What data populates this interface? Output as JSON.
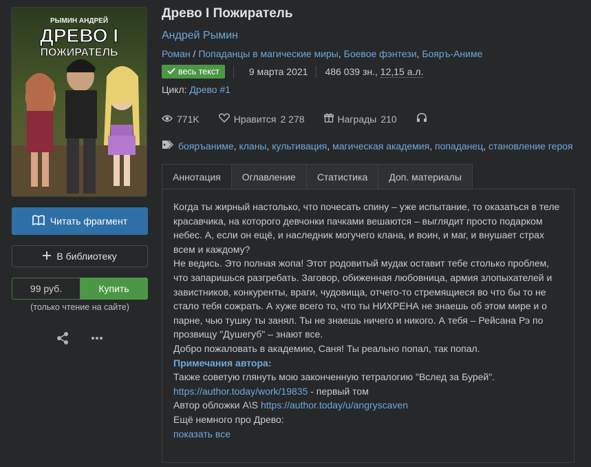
{
  "book": {
    "title": "Древо I Пожиратель",
    "author": "Андрей Рымин",
    "genre_main": "Роман",
    "genre_sep": " / ",
    "genres": [
      "Попаданцы в магические миры",
      "Боевое фэнтези",
      "Бояръ-Аниме"
    ],
    "status_badge": "весь текст",
    "date": "9 марта 2021",
    "size_chars": "486 039 зн., ",
    "size_al": "12,15 а.л.",
    "cycle_label": "Цикл:",
    "cycle_name": "Древо #1"
  },
  "cover": {
    "author_text": "РЫМИН АНДРЕЙ",
    "title_line1": "ДРЕВО I",
    "title_line2": "ПОЖИРАТЕЛЬ"
  },
  "stats": {
    "views": "771K",
    "likes_label": "Нравится",
    "likes": "2 278",
    "awards_label": "Награды",
    "awards": "210"
  },
  "tags": [
    "бояръаниме",
    "кланы",
    "культивация",
    "магическая академия",
    "попаданец",
    "становление героя"
  ],
  "tabs": [
    "Аннотация",
    "Оглавление",
    "Статистика",
    "Доп. материалы"
  ],
  "annotation": [
    "Когда ты жирный настолько, что почесать спину – уже испытание, то оказаться в теле красавчика, на которого девчонки пачками вешаются – выглядит просто подарком небес. А, если он ещё, и наследник могучего клана, и воин, и маг, и внушает страх всем и каждому?",
    "Не ведись. Это полная жопа! Этот родовитый мудак оставит тебе столько проблем, что запаришься разгребать. Заговор, обиженная любовница, армия злопыхателей и завистников, конкуренты, враги, чудовища, отчего-то стремящиеся во что бы то не стало тебя сожрать. А хуже всего то, что ты НИХРЕНА не знаешь об этом мире и о парне, чью тушку ты занял. Ты не знаешь ничего и никого. А тебя – Рейсана Рэ по прозвищу \"Душегуб\" – знают все.",
    "Добро пожаловать в академию, Саня! Ты реально попал, так попал."
  ],
  "notes": {
    "heading": "Примечания автора:",
    "line1": "Также советую глянуть мою законченную тетралогию \"Вслед за Бурей\".",
    "link1": "https://author.today/work/19835",
    "link1_suffix": " - первый том",
    "line3_prefix": "Автор обложки A\\S ",
    "link2": "https://author.today/u/angryscaven",
    "line4": "Ещё немного про Древо:",
    "show_all": "показать все"
  },
  "actions": {
    "read_fragment": "Читать фрагмент",
    "to_library": "В библиотеку",
    "price": "99 руб.",
    "buy": "Купить",
    "buy_note": "(только чтение на сайте)"
  }
}
